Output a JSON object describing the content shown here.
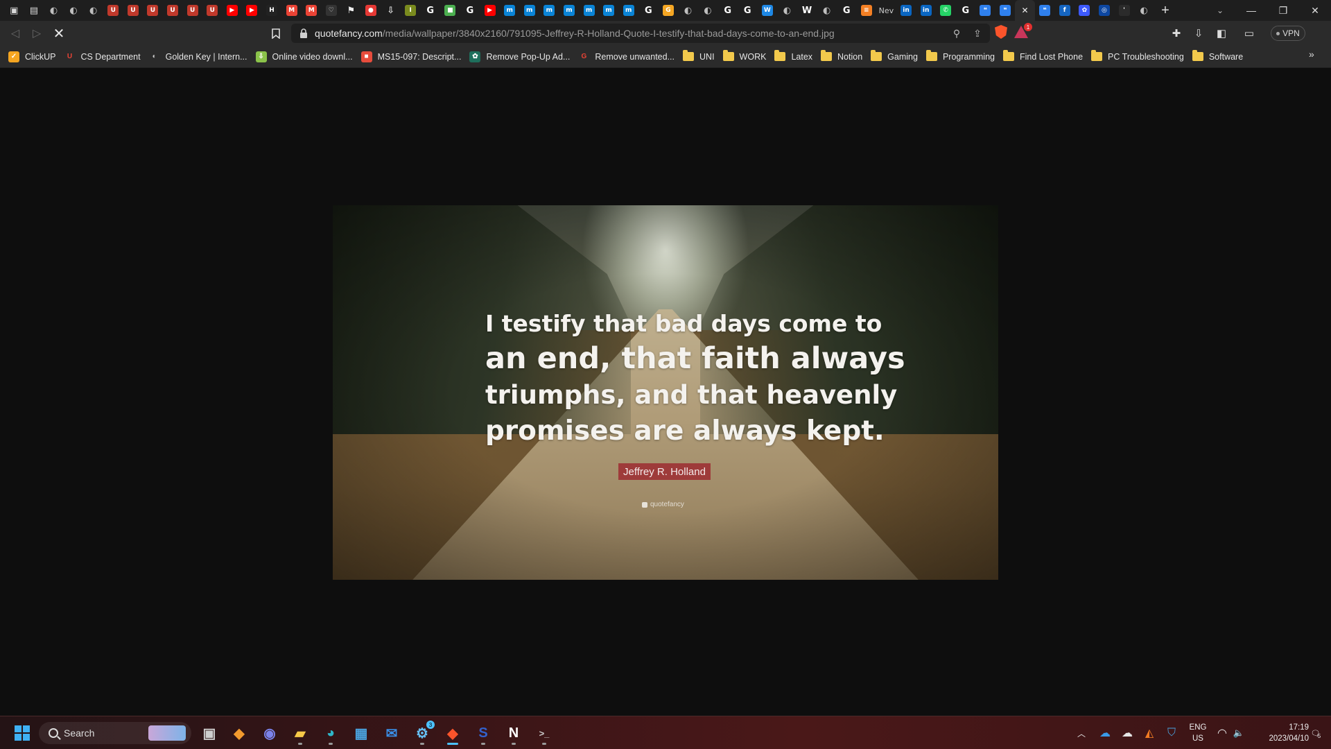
{
  "browser": {
    "tabs": [
      {
        "icon": "bookmark-icon",
        "color": "#d9d9d9",
        "glyph": "▣"
      },
      {
        "icon": "save-icon",
        "color": "#d9d9d9",
        "glyph": "▤"
      },
      {
        "icon": "globe-icon",
        "color": "#bfbfbf",
        "glyph": "◐"
      },
      {
        "icon": "globe-icon",
        "color": "#bfbfbf",
        "glyph": "◐"
      },
      {
        "icon": "globe-icon",
        "color": "#bfbfbf",
        "glyph": "◐"
      },
      {
        "icon": "university-icon",
        "color": "#c0392b",
        "glyph": "U"
      },
      {
        "icon": "university-icon",
        "color": "#c0392b",
        "glyph": "U"
      },
      {
        "icon": "university-icon",
        "color": "#c0392b",
        "glyph": "U"
      },
      {
        "icon": "university-icon",
        "color": "#c0392b",
        "glyph": "U"
      },
      {
        "icon": "university-icon",
        "color": "#c0392b",
        "glyph": "U"
      },
      {
        "icon": "university-icon",
        "color": "#c0392b",
        "glyph": "U"
      },
      {
        "icon": "youtube-icon",
        "color": "#ff0000",
        "glyph": "▶"
      },
      {
        "icon": "youtube-icon",
        "color": "#ff0000",
        "glyph": "▶"
      },
      {
        "icon": "hh-icon",
        "color": "#222222",
        "glyph": "H"
      },
      {
        "icon": "gmail-icon",
        "color": "#ea4335",
        "glyph": "M"
      },
      {
        "icon": "gmail-icon",
        "color": "#ea4335",
        "glyph": "M"
      },
      {
        "icon": "heart-icon",
        "color": "#333333",
        "glyph": "♡"
      },
      {
        "icon": "flag-icon",
        "color": "#eeeeee",
        "glyph": "⚑"
      },
      {
        "icon": "red-app-icon",
        "color": "#e53935",
        "glyph": "●"
      },
      {
        "icon": "download-icon",
        "color": "#dddddd",
        "glyph": "⇩"
      },
      {
        "icon": "ipc-icon",
        "color": "#7a8b1e",
        "glyph": "I"
      },
      {
        "icon": "google-icon",
        "color": "#ffffff",
        "glyph": "G"
      },
      {
        "icon": "microsoft-icon",
        "color": "#4caf50",
        "glyph": "■"
      },
      {
        "icon": "google-icon",
        "color": "#ffffff",
        "glyph": "G"
      },
      {
        "icon": "youtube-icon",
        "color": "#ff0000",
        "glyph": "▶"
      },
      {
        "icon": "mx-icon",
        "color": "#0a84d6",
        "glyph": "m"
      },
      {
        "icon": "mx-icon",
        "color": "#0a84d6",
        "glyph": "m"
      },
      {
        "icon": "mx-icon",
        "color": "#0a84d6",
        "glyph": "m"
      },
      {
        "icon": "mx-icon",
        "color": "#0a84d6",
        "glyph": "m"
      },
      {
        "icon": "mx-icon",
        "color": "#0a84d6",
        "glyph": "m"
      },
      {
        "icon": "mx-icon",
        "color": "#0a84d6",
        "glyph": "m"
      },
      {
        "icon": "mx-icon",
        "color": "#0a84d6",
        "glyph": "m"
      },
      {
        "icon": "google-icon",
        "color": "#ffffff",
        "glyph": "G"
      },
      {
        "icon": "gs-icon",
        "color": "#f5a623",
        "glyph": "G"
      },
      {
        "icon": "globe-icon",
        "color": "#bfbfbf",
        "glyph": "◐"
      },
      {
        "icon": "globe-icon",
        "color": "#bfbfbf",
        "glyph": "◐"
      },
      {
        "icon": "google-icon",
        "color": "#ffffff",
        "glyph": "G"
      },
      {
        "icon": "google-icon",
        "color": "#ffffff",
        "glyph": "G"
      },
      {
        "icon": "wordpress-icon",
        "color": "#1e88e5",
        "glyph": "W"
      },
      {
        "icon": "globe-icon",
        "color": "#bfbfbf",
        "glyph": "◐"
      },
      {
        "icon": "wiki-icon",
        "color": "#ffffff",
        "glyph": "W"
      },
      {
        "icon": "globe-icon",
        "color": "#bfbfbf",
        "glyph": "◐"
      },
      {
        "icon": "google-icon",
        "color": "#ffffff",
        "glyph": "G"
      },
      {
        "icon": "stackoverflow-icon",
        "color": "#f48024",
        "glyph": "≡"
      },
      {
        "icon": "new-tab-label-icon",
        "color": "#2b2b2b",
        "glyph": "Nev"
      },
      {
        "icon": "linkedin-icon",
        "color": "#0a66c2",
        "glyph": "in"
      },
      {
        "icon": "linkedin-icon",
        "color": "#0a66c2",
        "glyph": "in"
      },
      {
        "icon": "whatsapp-icon",
        "color": "#25d366",
        "glyph": "✆"
      },
      {
        "icon": "google-icon",
        "color": "#ffffff",
        "glyph": "G"
      },
      {
        "icon": "quotefancy-icon",
        "color": "#2f80ed",
        "glyph": "❝"
      },
      {
        "icon": "quotefancy-icon",
        "color": "#2f80ed",
        "glyph": "❝"
      },
      {
        "icon": "close-icon",
        "color": "#2b2b2b",
        "glyph": "✕",
        "active": true
      },
      {
        "icon": "quotefancy-icon",
        "color": "#2f80ed",
        "glyph": "❝"
      },
      {
        "icon": "blue-app-icon",
        "color": "#1565c0",
        "glyph": "f"
      },
      {
        "icon": "reddit-icon",
        "color": "#3d5afe",
        "glyph": "✿"
      },
      {
        "icon": "circle-icon",
        "color": "#0d47a1",
        "glyph": "◎"
      },
      {
        "icon": "quote-mark-icon",
        "color": "#2b2b2b",
        "glyph": "'"
      },
      {
        "icon": "globe-icon",
        "color": "#bfbfbf",
        "glyph": "◐"
      }
    ],
    "new_tab_glyph": "+",
    "tab_search_glyph": "⌄",
    "window_controls": {
      "minimize": "—",
      "restore": "❐",
      "close": "✕"
    },
    "nav": {
      "back": "◁",
      "forward": "▷",
      "stop": "✕"
    },
    "url": {
      "domain": "quotefancy.com",
      "path": "/media/wallpaper/3840x2160/791095-Jeffrey-R-Holland-Quote-I-testify-that-bad-days-come-to-an-end.jpg"
    },
    "url_icons": {
      "zoom": "⚲",
      "share": "⇪"
    },
    "rewards_badge": "1",
    "toolbar_icons": {
      "extensions": "✚",
      "downloads": "⇩",
      "sidebar": "◧",
      "wallet": "▭"
    },
    "vpn_label": "VPN"
  },
  "bookmarks": [
    {
      "label": "ClickUP",
      "type": "site",
      "color": "#f4a521",
      "glyph": "✓"
    },
    {
      "label": "CS Department",
      "type": "site",
      "color": "#ffffff",
      "glyph": "U"
    },
    {
      "label": "Golden Key | Intern...",
      "type": "site",
      "color": "#888888",
      "glyph": "◐"
    },
    {
      "label": "Online video downl...",
      "type": "site",
      "color": "#8bc34a",
      "glyph": "⇩"
    },
    {
      "label": "MS15-097: Descript...",
      "type": "site",
      "color": "#e74c3c",
      "glyph": "■"
    },
    {
      "label": "Remove Pop-Up Ad...",
      "type": "site",
      "color": "#1e6f5c",
      "glyph": "✿"
    },
    {
      "label": "Remove unwanted...",
      "type": "site",
      "color": "#ffffff",
      "glyph": "G"
    },
    {
      "label": "UNI",
      "type": "folder"
    },
    {
      "label": "WORK",
      "type": "folder"
    },
    {
      "label": "Latex",
      "type": "folder"
    },
    {
      "label": "Notion",
      "type": "folder"
    },
    {
      "label": "Gaming",
      "type": "folder"
    },
    {
      "label": "Programming",
      "type": "folder"
    },
    {
      "label": "Find Lost Phone",
      "type": "folder"
    },
    {
      "label": "PC Troubleshooting",
      "type": "folder"
    },
    {
      "label": "Software",
      "type": "folder"
    }
  ],
  "bookmarks_more": "»",
  "wallpaper": {
    "quote_lines": [
      "I testify that bad days come to",
      "an end, that faith always",
      "triumphs, and that heavenly",
      "promises are always kept."
    ],
    "author": "Jeffrey R. Holland",
    "watermark": "quotefancy"
  },
  "taskbar": {
    "search_label": "Search",
    "apps": [
      {
        "name": "task-view-icon",
        "glyph": "▣",
        "color": "#cfcfcf"
      },
      {
        "name": "sublime-icon",
        "glyph": "◆",
        "color": "#f29a2e"
      },
      {
        "name": "teams-chat-icon",
        "glyph": "◉",
        "color": "#7b83eb"
      },
      {
        "name": "file-explorer-icon",
        "glyph": "▰",
        "color": "#f7c948"
      },
      {
        "name": "edge-icon",
        "glyph": "◕",
        "color": "#2fb7c9"
      },
      {
        "name": "microsoft-store-icon",
        "glyph": "▦",
        "color": "#4aa3df"
      },
      {
        "name": "mail-icon",
        "glyph": "✉",
        "color": "#3a8ee6"
      },
      {
        "name": "steam-icon",
        "glyph": "⚙",
        "color": "#66c0f4",
        "badge": "3"
      },
      {
        "name": "brave-icon",
        "glyph": "◆",
        "color": "#fb542b"
      },
      {
        "name": "simplenote-icon",
        "glyph": "S",
        "color": "#3361cc"
      },
      {
        "name": "notion-icon",
        "glyph": "N",
        "color": "#ffffff"
      },
      {
        "name": "terminal-icon",
        "glyph": ">_",
        "color": "#cccccc"
      }
    ],
    "tray": {
      "chevron": "︿",
      "onedrive": "☁",
      "cloud": "☁",
      "avast": "◭",
      "defender": "⛉",
      "lang_top": "ENG",
      "lang_bottom": "US",
      "wifi": "◠",
      "volume": "🔈",
      "time": "17:19",
      "date": "2023/04/10",
      "notification_badge": "5"
    }
  }
}
